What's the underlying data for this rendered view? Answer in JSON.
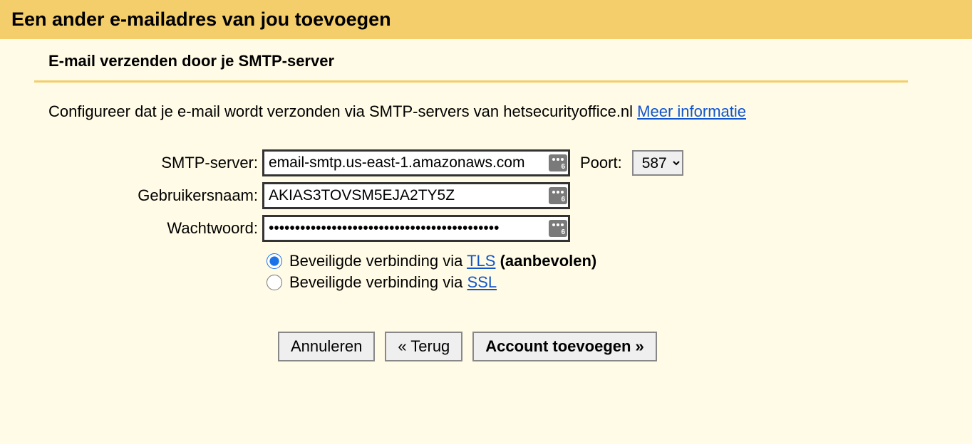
{
  "header": {
    "title": "Een ander e-mailadres van jou toevoegen"
  },
  "subheader": "E-mail verzenden door je SMTP-server",
  "instruction": {
    "text": "Configureer dat je e-mail wordt verzonden via SMTP-servers van hetsecurityoffice.nl ",
    "link_text": "Meer informatie"
  },
  "form": {
    "smtp_label": "SMTP-server:",
    "smtp_value": "email-smtp.us-east-1.amazonaws.com",
    "port_label": "Poort:",
    "port_value": "587",
    "username_label": "Gebruikersnaam:",
    "username_value": "AKIAS3TOVSM5EJA2TY5Z",
    "password_label": "Wachtwoord:",
    "password_value": "••••••••••••••••••••••••••••••••••••••••••••"
  },
  "security": {
    "tls_prefix": "Beveiligde verbinding via ",
    "tls_link": "TLS",
    "tls_suffix": " (aanbevolen)",
    "ssl_prefix": "Beveiligde verbinding via ",
    "ssl_link": "SSL",
    "selected": "tls"
  },
  "buttons": {
    "cancel": "Annuleren",
    "back": "« Terug",
    "add": "Account toevoegen »"
  },
  "pw_badge_num": "6"
}
